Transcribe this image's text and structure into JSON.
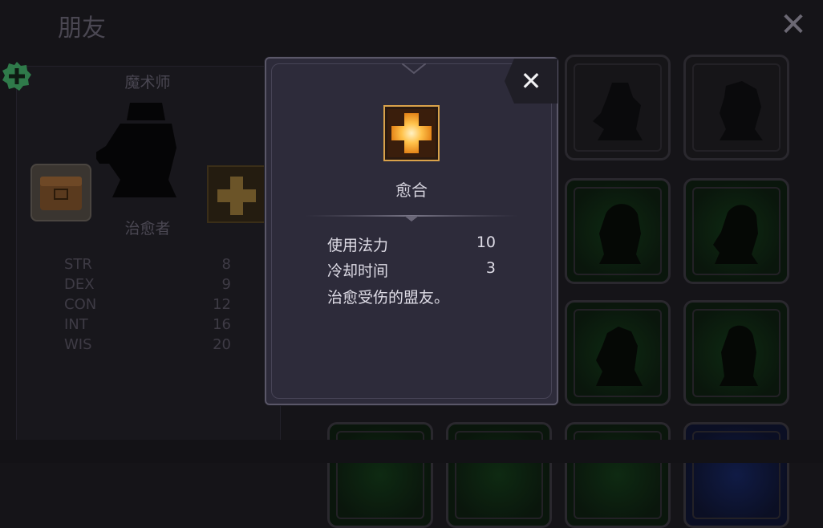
{
  "background": {
    "title": "朋友",
    "close_icon": "close-icon",
    "character": {
      "class_name": "魔术师",
      "hero_name": "治愈者",
      "stats": [
        {
          "label": "STR",
          "value": "8"
        },
        {
          "label": "DEX",
          "value": "9"
        },
        {
          "label": "CON",
          "value": "12"
        },
        {
          "label": "INT",
          "value": "16"
        },
        {
          "label": "WIS",
          "value": "20"
        }
      ]
    }
  },
  "modal": {
    "skill_name": "愈合",
    "rows": [
      {
        "label": "使用法力",
        "value": "10"
      },
      {
        "label": "冷却时间",
        "value": "3"
      }
    ],
    "description": "治愈受伤的盟友。",
    "close_icon": "close-icon"
  },
  "colors": {
    "accent_gold": "#f5a623",
    "badge_green": "#2f7a4a",
    "modal_bg": "#2d2b3a"
  }
}
